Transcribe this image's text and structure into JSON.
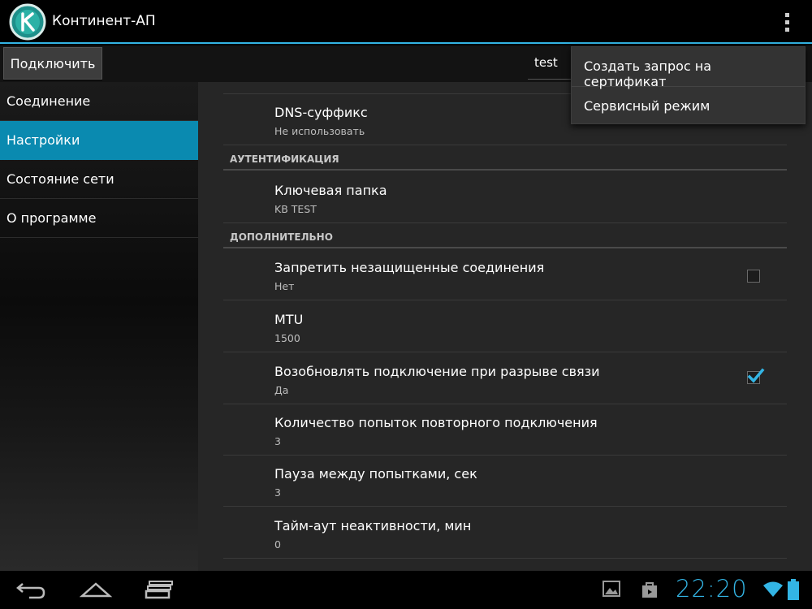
{
  "app": {
    "title": "Континент-АП",
    "logo_icon": "continent-logo-icon",
    "overflow_icon": "overflow-menu-icon"
  },
  "toolbar": {
    "connect_label": "Подключить",
    "profile_value": "test"
  },
  "sidebar": {
    "items": [
      {
        "label": "Соединение",
        "active": false
      },
      {
        "label": "Настройки",
        "active": true
      },
      {
        "label": "Состояние сети",
        "active": false
      },
      {
        "label": "О программе",
        "active": false
      }
    ]
  },
  "settings": {
    "dns": {
      "title": "DNS-суффикс",
      "summary": "Не использовать"
    },
    "auth_section": "АУТЕНТИФИКАЦИЯ",
    "key_folder": {
      "title": "Ключевая папка",
      "summary": "KB TEST"
    },
    "extra_section": "ДОПОЛНИТЕЛЬНО",
    "forbid_insecure": {
      "title": "Запретить незащищенные соединения",
      "summary": "Нет",
      "checked": false
    },
    "mtu": {
      "title": "MTU",
      "summary": "1500"
    },
    "reconnect": {
      "title": "Возобновлять подключение при разрыве связи",
      "summary": "Да",
      "checked": true
    },
    "retry_count": {
      "title": "Количество попыток повторного подключения",
      "summary": "3"
    },
    "retry_pause": {
      "title": "Пауза между попытками, сек",
      "summary": "3"
    },
    "idle_timeout": {
      "title": "Тайм-аут неактивности, мин",
      "summary": "0"
    }
  },
  "overflow_menu": {
    "items": [
      {
        "label": "Создать запрос на сертификат"
      },
      {
        "label": "Сервисный режим"
      }
    ]
  },
  "system_bar": {
    "clock": "22:20",
    "icons": [
      "back-icon",
      "home-icon",
      "recents-icon",
      "gallery-notification-icon",
      "store-notification-icon",
      "wifi-icon",
      "battery-icon"
    ]
  },
  "colors": {
    "accent": "#33b5e5",
    "active_nav": "#0a8ab0",
    "content_bg": "#262626"
  }
}
